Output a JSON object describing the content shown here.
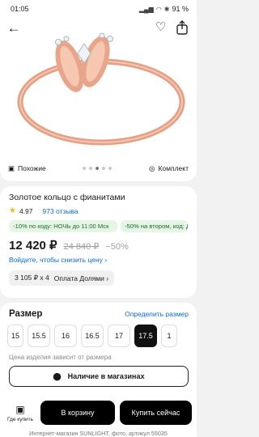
{
  "status": {
    "time": "01:05",
    "battery": "91 %"
  },
  "product": {
    "title": "Золотое кольцо с фианитами",
    "rating": "4.97",
    "reviews": "973 отзыва",
    "promos": [
      "-10% по коду: НОЧЬ до 11:00 Мск",
      "-50% на втором, код: ДВА"
    ],
    "price": "12 420 ₽",
    "old_price": "24 840 ₽",
    "discount": "−50%",
    "price_hint": "Войдите, чтобы снизить цену ›",
    "installment": {
      "left": "3 105 ₽ х 4",
      "right": "Оплата Долями ›"
    }
  },
  "hero": {
    "left_label": "Похожие",
    "right_label": "Комплект",
    "slides": 5,
    "active_slide": 3
  },
  "sizes": {
    "heading": "Размер",
    "action": "Определить размер",
    "options": [
      "15",
      "15.5",
      "16",
      "16.5",
      "17",
      "17.5",
      "1"
    ],
    "selected": "17.5",
    "note": "Цена изделия зависит от размера",
    "stores_button": "Наличие в магазинах"
  },
  "actions": {
    "where": "Где купить",
    "cart": "В корзину",
    "buy": "Купить сейчас",
    "footer": "Интернет-магазин SUNLIGHT, фото, артикул 55035"
  },
  "colors": {
    "link": "#0a6bd8",
    "promo_bg": "#e6f6e6",
    "promo_text": "#1d6a2a",
    "star": "#f3b51a"
  }
}
